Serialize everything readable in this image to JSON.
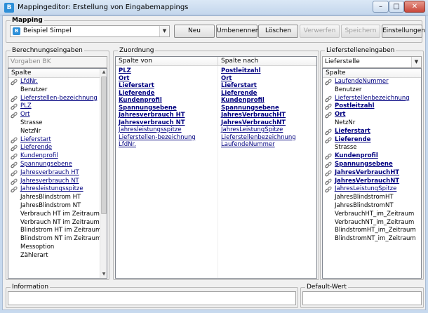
{
  "window": {
    "title": "Mappingeditor: Erstellung von Eingabemappings",
    "icon_text": "B"
  },
  "mapping": {
    "legend": "Mapping",
    "selected": "Beispiel Simpel",
    "buttons": {
      "neu": "Neu",
      "umbenennen": "Umbenennen",
      "loeschen": "Löschen",
      "verwerfen": "Verwerfen",
      "speichern": "Speichern",
      "einstellungen": "Einstellungen"
    }
  },
  "berechnung": {
    "legend": "Berechnungseingaben",
    "combo": "Vorgaben BK",
    "header": "Spalte",
    "items": [
      {
        "label": "LfdNr.",
        "linked": true,
        "bold": false
      },
      {
        "label": "Benutzer",
        "linked": false,
        "bold": false
      },
      {
        "label": "Lieferstellen-bezeichnung",
        "linked": true,
        "bold": false
      },
      {
        "label": "PLZ",
        "linked": true,
        "bold": false
      },
      {
        "label": "Ort",
        "linked": true,
        "bold": false
      },
      {
        "label": "Strasse",
        "linked": false,
        "bold": false
      },
      {
        "label": "NetzNr",
        "linked": false,
        "bold": false
      },
      {
        "label": "Lieferstart",
        "linked": true,
        "bold": false
      },
      {
        "label": "Lieferende",
        "linked": true,
        "bold": false
      },
      {
        "label": "Kundenprofil",
        "linked": true,
        "bold": false
      },
      {
        "label": "Spannungsebene",
        "linked": true,
        "bold": false
      },
      {
        "label": "Jahresverbrauch HT",
        "linked": true,
        "bold": false
      },
      {
        "label": "Jahresverbrauch NT",
        "linked": true,
        "bold": false
      },
      {
        "label": "Jahresleistungsspitze",
        "linked": true,
        "bold": false
      },
      {
        "label": "JahresBlindstrom HT",
        "linked": false,
        "bold": false
      },
      {
        "label": "JahresBlindstrom NT",
        "linked": false,
        "bold": false
      },
      {
        "label": "Verbrauch HT im Zeitraum",
        "linked": false,
        "bold": false
      },
      {
        "label": "Verbrauch NT im Zeitraum",
        "linked": false,
        "bold": false
      },
      {
        "label": "Blindstrom HT im Zeitraum",
        "linked": false,
        "bold": false
      },
      {
        "label": "Blindstrom NT im Zeitraum",
        "linked": false,
        "bold": false
      },
      {
        "label": "Messoption",
        "linked": false,
        "bold": false
      },
      {
        "label": "Zählerart",
        "linked": false,
        "bold": false
      }
    ]
  },
  "zuordnung": {
    "legend": "Zuordnung",
    "header_from": "Spalte von",
    "header_to": "Spalte nach",
    "rows": [
      {
        "from": "PLZ",
        "to": "Postleitzahl",
        "bold": true
      },
      {
        "from": "Ort",
        "to": "Ort",
        "bold": true
      },
      {
        "from": "Lieferstart",
        "to": "Lieferstart",
        "bold": true
      },
      {
        "from": "Lieferende",
        "to": "Lieferende",
        "bold": true
      },
      {
        "from": "Kundenprofil",
        "to": "Kundenprofil",
        "bold": true
      },
      {
        "from": "Spannungsebene",
        "to": "Spannungsebene",
        "bold": true
      },
      {
        "from": "Jahresverbrauch HT",
        "to": "JahresVerbrauchHT",
        "bold": true
      },
      {
        "from": "Jahresverbrauch NT",
        "to": "JahresVerbrauchNT",
        "bold": true
      },
      {
        "from": "Jahresleistungsspitze",
        "to": "JahresLeistungSpitze",
        "bold": false
      },
      {
        "from": "Lieferstellen-bezeichnung",
        "to": "Lieferstellenbezeichnung",
        "bold": false
      },
      {
        "from": "LfdNr.",
        "to": "LaufendeNummer",
        "bold": false
      }
    ]
  },
  "lieferstellen": {
    "legend": "Lieferstelleneingaben",
    "combo": "Lieferstelle",
    "header": "Spalte",
    "items": [
      {
        "label": "LaufendeNummer",
        "linked": true,
        "bold": false
      },
      {
        "label": "Benutzer",
        "linked": false,
        "bold": false
      },
      {
        "label": "Lieferstellenbezeichnung",
        "linked": true,
        "bold": false
      },
      {
        "label": "Postleitzahl",
        "linked": true,
        "bold": true
      },
      {
        "label": "Ort",
        "linked": true,
        "bold": true
      },
      {
        "label": "NetzNr",
        "linked": false,
        "bold": false
      },
      {
        "label": "Lieferstart",
        "linked": true,
        "bold": true
      },
      {
        "label": "Lieferende",
        "linked": true,
        "bold": true
      },
      {
        "label": "Strasse",
        "linked": false,
        "bold": false
      },
      {
        "label": "Kundenprofil",
        "linked": true,
        "bold": true
      },
      {
        "label": "Spannungsebene",
        "linked": true,
        "bold": true
      },
      {
        "label": "JahresVerbrauchHT",
        "linked": true,
        "bold": true
      },
      {
        "label": "JahresVerbrauchNT",
        "linked": true,
        "bold": true
      },
      {
        "label": "JahresLeistungSpitze",
        "linked": true,
        "bold": false
      },
      {
        "label": "JahresBlindstromHT",
        "linked": false,
        "bold": false
      },
      {
        "label": "JahresBlindstromNT",
        "linked": false,
        "bold": false
      },
      {
        "label": "VerbrauchHT_im_Zeitraum",
        "linked": false,
        "bold": false
      },
      {
        "label": "VerbrauchNT_im_Zeitraum",
        "linked": false,
        "bold": false
      },
      {
        "label": "BlindstromHT_im_Zeitraum",
        "linked": false,
        "bold": false
      },
      {
        "label": "BlindstromNT_im_Zeitraum",
        "linked": false,
        "bold": false
      }
    ]
  },
  "information": {
    "legend": "Information",
    "value": ""
  },
  "default_wert": {
    "legend": "Default-Wert",
    "value": ""
  },
  "icons": {
    "link": "link-icon",
    "app": "app-icon"
  }
}
